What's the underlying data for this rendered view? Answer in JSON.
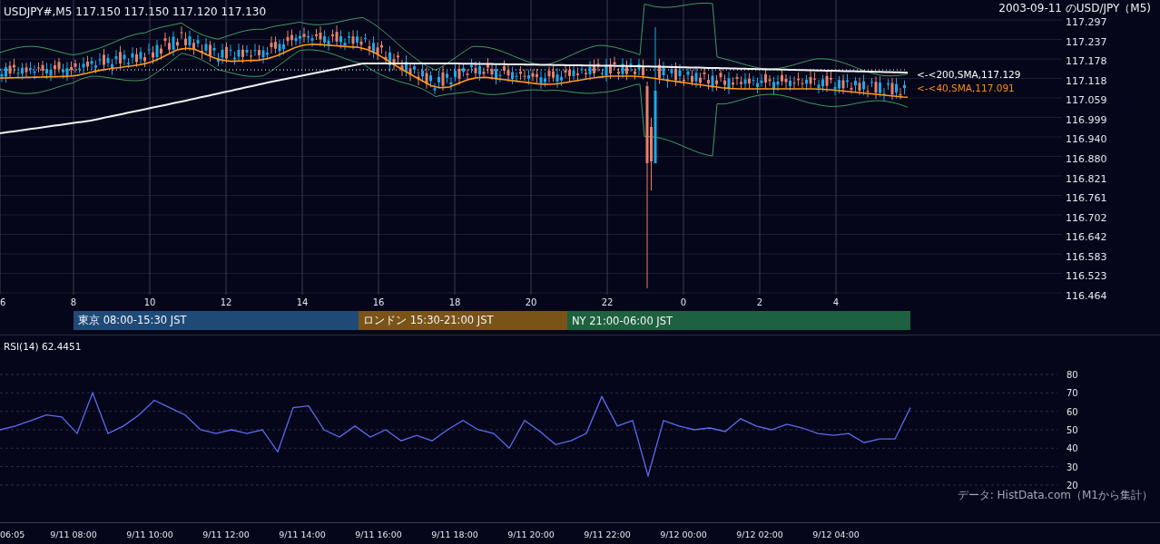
{
  "header": {
    "symbol_quote": "USDJPY#,M5 117.150 117.150 117.120 117.130",
    "title": "2003-09-11 のUSD/JPY（M5)"
  },
  "price_axis": [
    "117.297",
    "117.237",
    "117.178",
    "117.118",
    "117.059",
    "116.999",
    "116.940",
    "116.880",
    "116.821",
    "116.761",
    "116.702",
    "116.642",
    "116.583",
    "116.523",
    "116.464"
  ],
  "indicator_labels": [
    {
      "text": "<-<200,SMA,117.129",
      "color": "#ffffff"
    },
    {
      "text": "<-<40,SMA,117.091",
      "color": "#ff8c1a"
    }
  ],
  "hour_axis": [
    "6",
    "8",
    "10",
    "12",
    "14",
    "16",
    "18",
    "20",
    "22",
    "0",
    "2",
    "4"
  ],
  "sessions": [
    {
      "label": "東京 08:00-15:30 JST",
      "color": "#1f4a78"
    },
    {
      "label": "ロンドン 15:30-21:00 JST",
      "color": "#7a5317"
    },
    {
      "label": "NY 21:00-06:00 JST",
      "color": "#1e6140"
    }
  ],
  "rsi": {
    "title": "RSI(14) 62.4451",
    "chart_data": {
      "type": "line",
      "grid": true,
      "ylim": [
        20,
        80
      ],
      "yticks": [
        20,
        30,
        40,
        50,
        60,
        70,
        80
      ],
      "series": [
        {
          "color": "#5b6cf0",
          "values": [
            50,
            52,
            55,
            58,
            57,
            48,
            70,
            48,
            52,
            58,
            66,
            62,
            58,
            50,
            48,
            50,
            48,
            50,
            38,
            62,
            63,
            50,
            46,
            52,
            46,
            50,
            44,
            47,
            44,
            50,
            55,
            50,
            48,
            40,
            55,
            49,
            42,
            44,
            48,
            68,
            52,
            55,
            25,
            55,
            52,
            50,
            51,
            49,
            56,
            52,
            50,
            53,
            51,
            48,
            47,
            48,
            43,
            45,
            45,
            62
          ]
        }
      ]
    }
  },
  "source_note": "データ: HistData.com（M1から集計）",
  "time_axis": [
    "06:05",
    "9/11 08:00",
    "9/11 10:00",
    "9/11 12:00",
    "9/11 14:00",
    "9/11 16:00",
    "9/11 18:00",
    "9/11 20:00",
    "9/11 22:00",
    "9/12 00:00",
    "9/12 02:00",
    "9/12 04:00"
  ]
}
